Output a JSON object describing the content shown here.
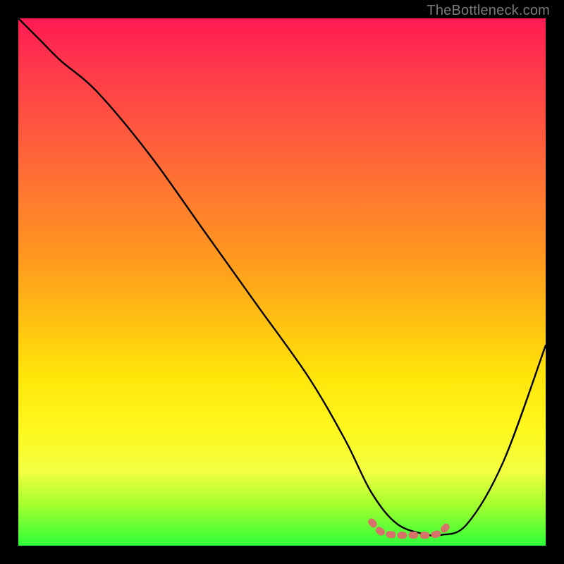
{
  "attribution": "TheBottleneck.com",
  "chart_data": {
    "type": "line",
    "title": "",
    "xlabel": "",
    "ylabel": "",
    "xlim": [
      0,
      100
    ],
    "ylim": [
      0,
      100
    ],
    "series": [
      {
        "name": "bottleneck-curve",
        "color": "#000000",
        "x": [
          0,
          4,
          8,
          15,
          25,
          35,
          45,
          55,
          62,
          67,
          72,
          78,
          80,
          85,
          92,
          100
        ],
        "y": [
          100,
          96,
          92,
          86,
          74,
          60,
          46,
          32,
          20,
          10,
          4,
          2,
          2,
          4,
          16,
          38
        ]
      },
      {
        "name": "optimal-range",
        "color": "#d9716b",
        "x": [
          67,
          69,
          72,
          75,
          78,
          80,
          82
        ],
        "y": [
          4.5,
          2.5,
          2.0,
          2.0,
          2.0,
          2.5,
          4.5
        ]
      }
    ],
    "annotations": []
  }
}
